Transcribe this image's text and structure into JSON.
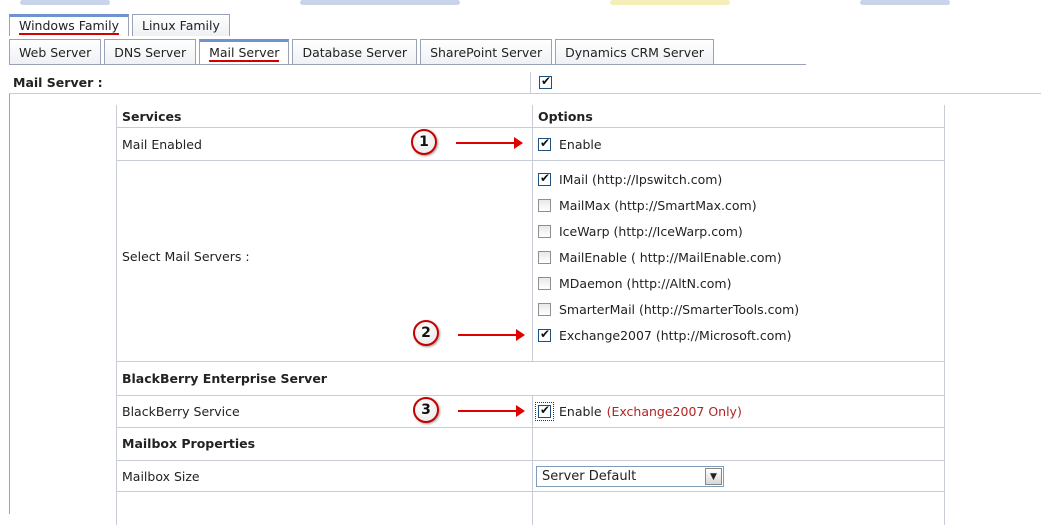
{
  "tabs_top": [
    {
      "label": "Windows Family",
      "active": true
    },
    {
      "label": "Linux Family",
      "active": false
    }
  ],
  "tabs_sub": [
    {
      "label": "Web Server",
      "active": false
    },
    {
      "label": "DNS Server",
      "active": false
    },
    {
      "label": "Mail Server",
      "active": true
    },
    {
      "label": "Database Server",
      "active": false
    },
    {
      "label": "SharePoint Server",
      "active": false
    },
    {
      "label": "Dynamics CRM Server",
      "active": false
    }
  ],
  "mail_server_label": "Mail Server :",
  "mail_server_checked": true,
  "table": {
    "col_services": "Services",
    "col_options": "Options",
    "mail_enabled_label": "Mail Enabled",
    "mail_enabled_option": "Enable",
    "select_servers_label": "Select Mail Servers :",
    "servers": [
      {
        "label": "IMail (http://Ipswitch.com)",
        "checked": true
      },
      {
        "label": "MailMax (http://SmartMax.com)",
        "checked": false
      },
      {
        "label": "IceWarp (http://IceWarp.com)",
        "checked": false
      },
      {
        "label": "MailEnable ( http://MailEnable.com)",
        "checked": false
      },
      {
        "label": "MDaemon (http://AltN.com)",
        "checked": false
      },
      {
        "label": "SmarterMail (http://SmarterTools.com)",
        "checked": false
      },
      {
        "label": "Exchange2007 (http://Microsoft.com)",
        "checked": true
      }
    ],
    "bes_header": "BlackBerry Enterprise Server",
    "bes_service_label": "BlackBerry Service",
    "bes_enable": "Enable",
    "bes_note": "(Exchange2007 Only)",
    "mailbox_header": "Mailbox Properties",
    "mailbox_size_label": "Mailbox Size",
    "mailbox_size_value": "Server Default"
  },
  "annotations": [
    "1",
    "2",
    "3"
  ],
  "colors": {
    "accent_tab": "#6e93cf",
    "underline_red": "#d40000",
    "note_red": "#b22222",
    "arrow_red": "#e00000"
  }
}
